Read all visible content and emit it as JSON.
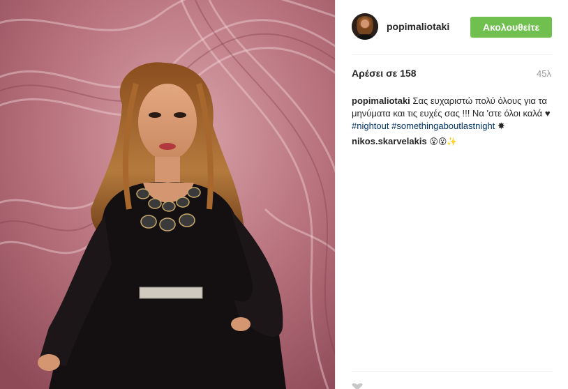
{
  "post": {
    "username": "popimaliotaki",
    "follow_label": "Ακολουθείτε",
    "likes_text": "Αρέσει σε 158",
    "time_ago": "45λ",
    "caption": {
      "author": "popimaliotaki",
      "text_1": "Σας ευχαριστώ πολύ όλους για τα μηνύματα και τις ευχές σας !!! Να 'στε όλοι καλά",
      "heart": "♥",
      "hashtag_1": "#nightout",
      "hashtag_2": "#somethingaboutlastnight",
      "star": "✸"
    },
    "comments": [
      {
        "author": "nikos.skarvelakis",
        "text": "😮😮✨"
      }
    ]
  },
  "colors": {
    "follow_button": "#70c050",
    "hashtag": "#003569",
    "text": "#262626",
    "muted": "#999999"
  },
  "icons": {
    "avatar": "profile-photo",
    "bottom": "heart-icon"
  }
}
